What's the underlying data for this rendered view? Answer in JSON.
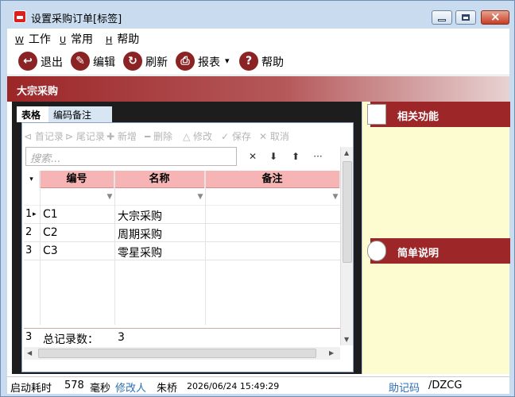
{
  "window": {
    "title": "设置采购订单[标签]",
    "min_label": "",
    "max_label": "",
    "close_label": "×"
  },
  "menu": {
    "items": [
      {
        "key": "W",
        "label": "工作"
      },
      {
        "key": "U",
        "label": "常用"
      },
      {
        "key": "H",
        "label": "帮助"
      }
    ]
  },
  "toolbar": {
    "exit": "退出",
    "edit": "编辑",
    "refresh": "刷新",
    "report": "报表",
    "report_arrow": "▾",
    "help": "帮助"
  },
  "section_title": "大宗采购",
  "tabs": [
    {
      "label": "表格"
    },
    {
      "label": "编码备注"
    }
  ],
  "nav": {
    "first": "⊲ 首记录",
    "last": "⊳ 尾记录",
    "add": "✚ 新增",
    "delete": "━ 删除",
    "modify": "△ 修改",
    "save": "✓ 保存",
    "cancel": "✕ 取消"
  },
  "search": {
    "placeholder": "搜索...",
    "clear": "✕",
    "down": "⬇",
    "up": "⬆",
    "more": "···"
  },
  "grid": {
    "columns": [
      "编号",
      "名称",
      "备注"
    ],
    "rows": [
      {
        "num": "1",
        "code": "C1",
        "name": "大宗采购",
        "note": ""
      },
      {
        "num": "2",
        "code": "C2",
        "name": "周期采购",
        "note": ""
      },
      {
        "num": "3",
        "code": "C3",
        "name": "零星采购",
        "note": ""
      }
    ],
    "current_marker": "▸",
    "footer": {
      "num": "3",
      "label": "总记录数：",
      "value": "3"
    }
  },
  "right_panel": {
    "related": "相关功能",
    "brief": "简单说明"
  },
  "status": {
    "startup_label": "启动耗时",
    "startup_value": "578",
    "unit": "毫秒",
    "modifier_label": "修改人",
    "modifier": "朱桥",
    "datetime": "2026/06/24 15:49:29",
    "mnemonic_label": "助记码",
    "mnemonic": "/DZCG"
  }
}
